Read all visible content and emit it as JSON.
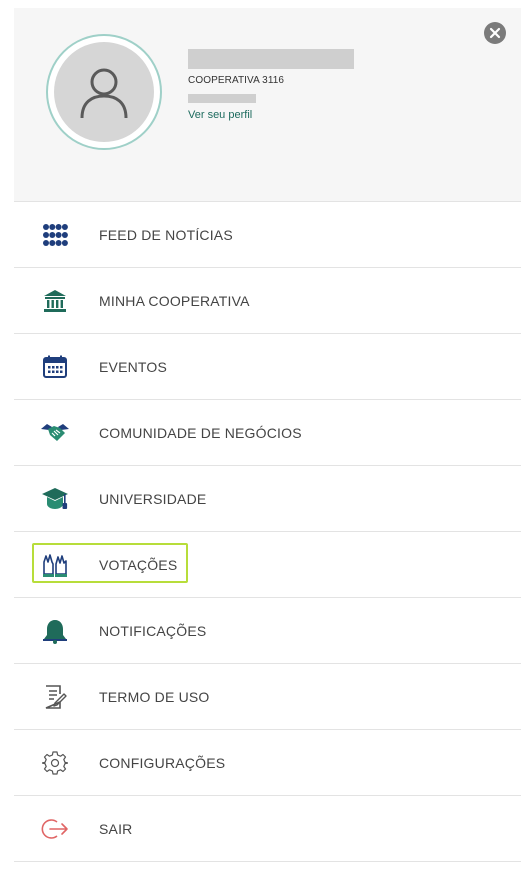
{
  "profile": {
    "cooperative": "COOPERATIVA 3116",
    "profile_link": "Ver seu perfil"
  },
  "colors": {
    "primary": "#1d6b5e",
    "icon_blue": "#1f3e7c",
    "icon_teal": "#2a8c72",
    "exit_red": "#e06565",
    "highlight": "#b7dd3a"
  },
  "menu": {
    "items": [
      {
        "label": "FEED DE NOTÍCIAS",
        "icon": "grid-dots-icon"
      },
      {
        "label": "MINHA COOPERATIVA",
        "icon": "bank-building-icon"
      },
      {
        "label": "EVENTOS",
        "icon": "calendar-icon"
      },
      {
        "label": "COMUNIDADE DE NEGÓCIOS",
        "icon": "handshake-icon"
      },
      {
        "label": "UNIVERSIDADE",
        "icon": "graduation-cap-icon"
      },
      {
        "label": "VOTAÇÕES",
        "icon": "raised-hands-icon"
      },
      {
        "label": "NOTIFICAÇÕES",
        "icon": "bell-icon"
      },
      {
        "label": "TERMO DE USO",
        "icon": "document-edit-icon"
      },
      {
        "label": "CONFIGURAÇÕES",
        "icon": "gear-icon"
      },
      {
        "label": "SAIR",
        "icon": "exit-arrow-icon"
      }
    ]
  }
}
